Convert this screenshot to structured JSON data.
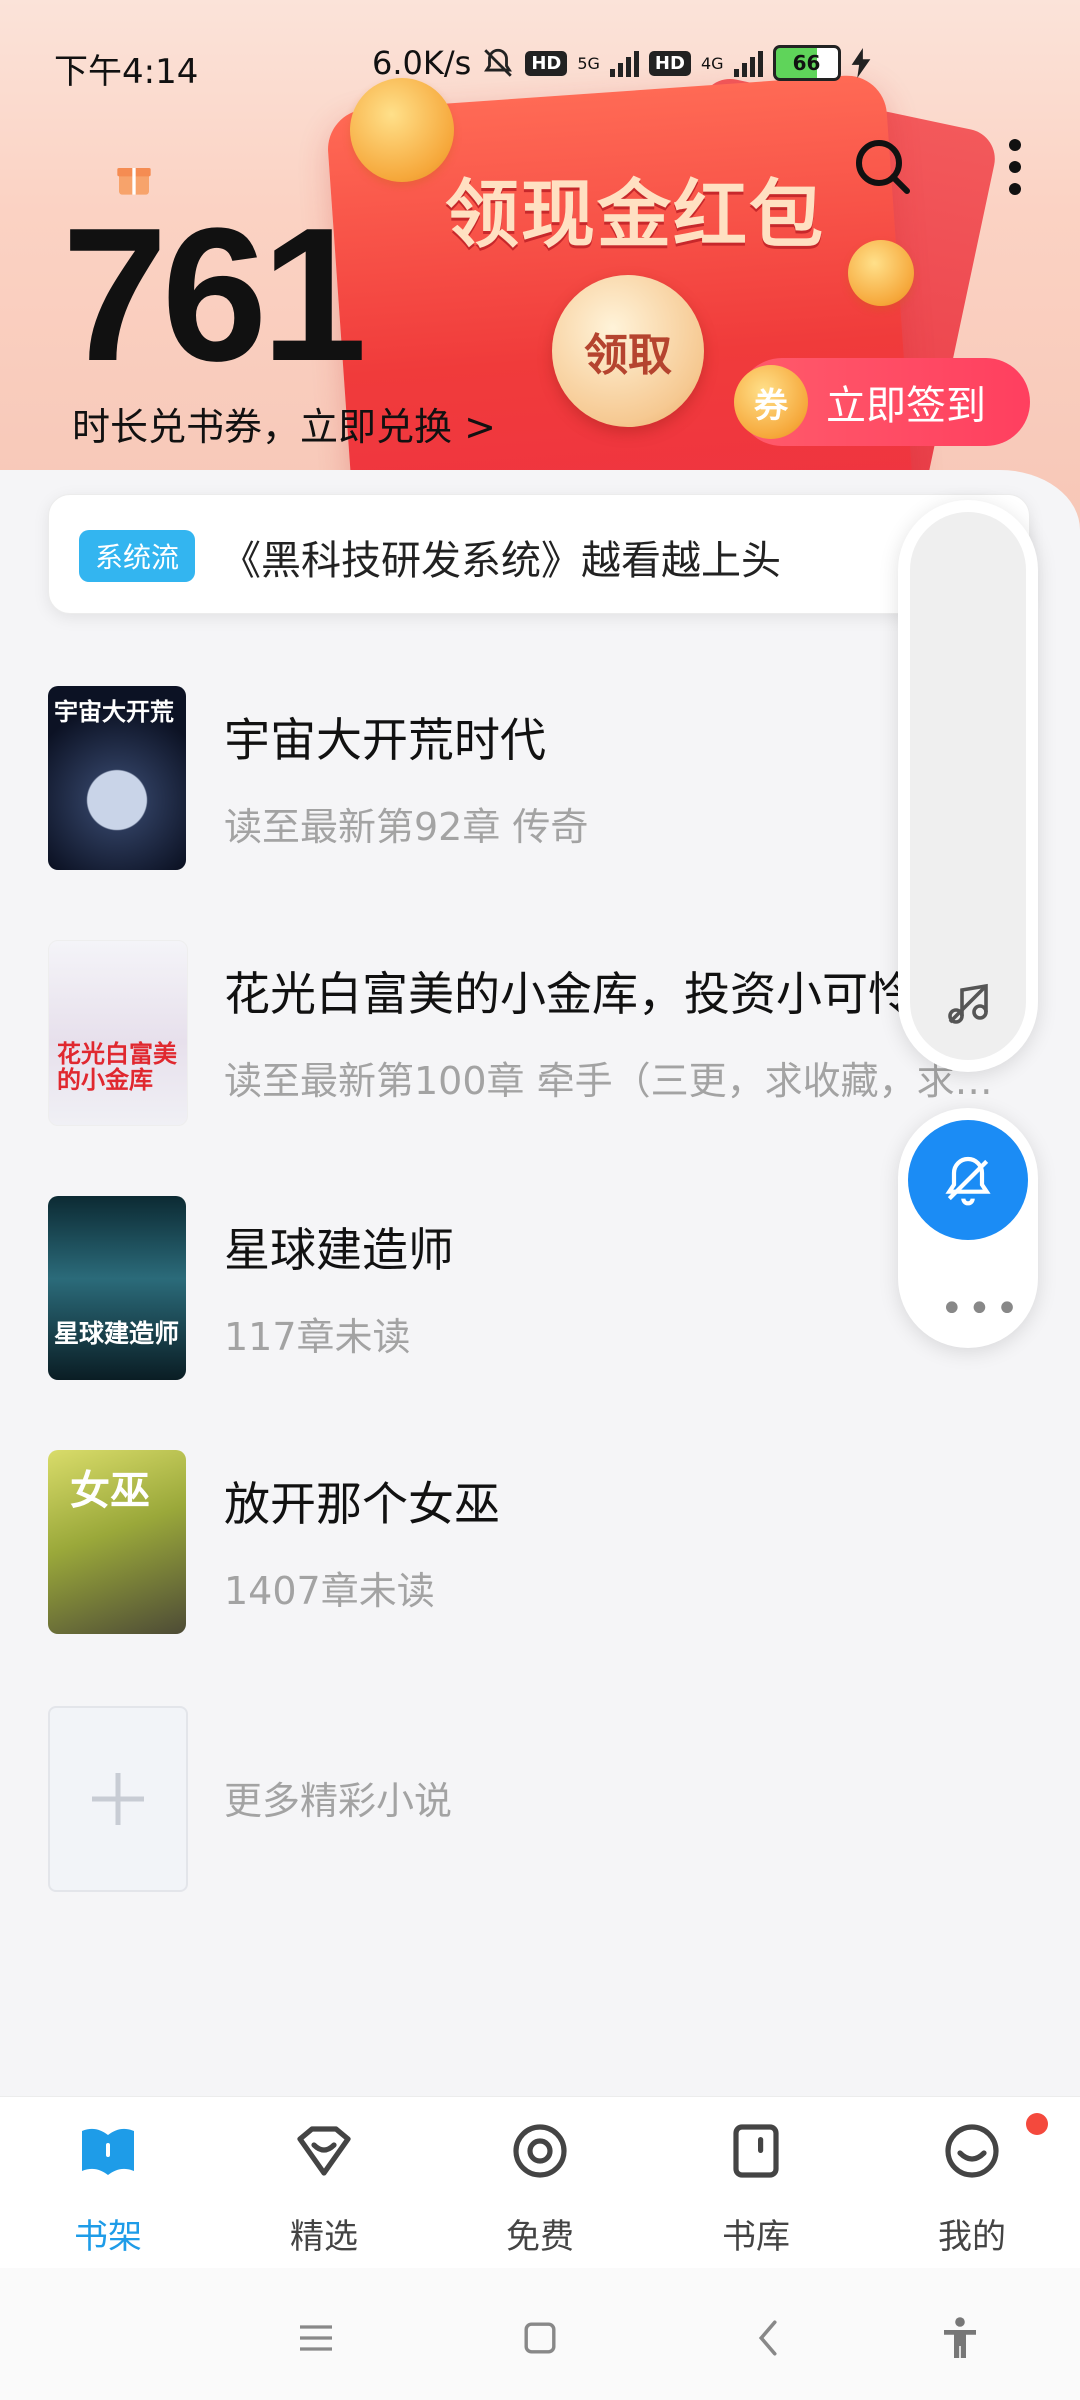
{
  "status_bar": {
    "time": "下午4:14",
    "speed": "6.0K/s",
    "hd1": "HD",
    "net1": "5G",
    "hd2": "HD",
    "net2": "4G",
    "battery": "66"
  },
  "hero": {
    "balance": "761",
    "exchange_text": "时长兑书券，立即兑换 >",
    "envelope_title": "领现金红包",
    "claim_label": "领取",
    "sign_coin": "券",
    "sign_label": "立即签到"
  },
  "notice": {
    "tag": "系统流",
    "text": "《黑科技研发系统》越看越上头"
  },
  "books": [
    {
      "title": "宇宙大开荒时代",
      "meta": "读至最新第92章 传奇"
    },
    {
      "title": "花光白富美的小金库，投资小可怜",
      "meta": "读至最新第100章 牵手（三更，求收藏，求…"
    },
    {
      "title": "星球建造师",
      "meta": "117章未读"
    },
    {
      "title": "放开那个女巫",
      "meta": "1407章未读"
    }
  ],
  "more_books": "更多精彩小说",
  "nav": [
    {
      "label": "书架",
      "icon": "bookshelf-icon",
      "active": true
    },
    {
      "label": "精选",
      "icon": "featured-icon"
    },
    {
      "label": "免费",
      "icon": "free-icon"
    },
    {
      "label": "书库",
      "icon": "library-icon"
    },
    {
      "label": "我的",
      "icon": "profile-icon"
    }
  ],
  "colors": {
    "accent": "#1e9ce8",
    "envelope": "#f03b3b",
    "float_button": "#1b8cf5"
  }
}
